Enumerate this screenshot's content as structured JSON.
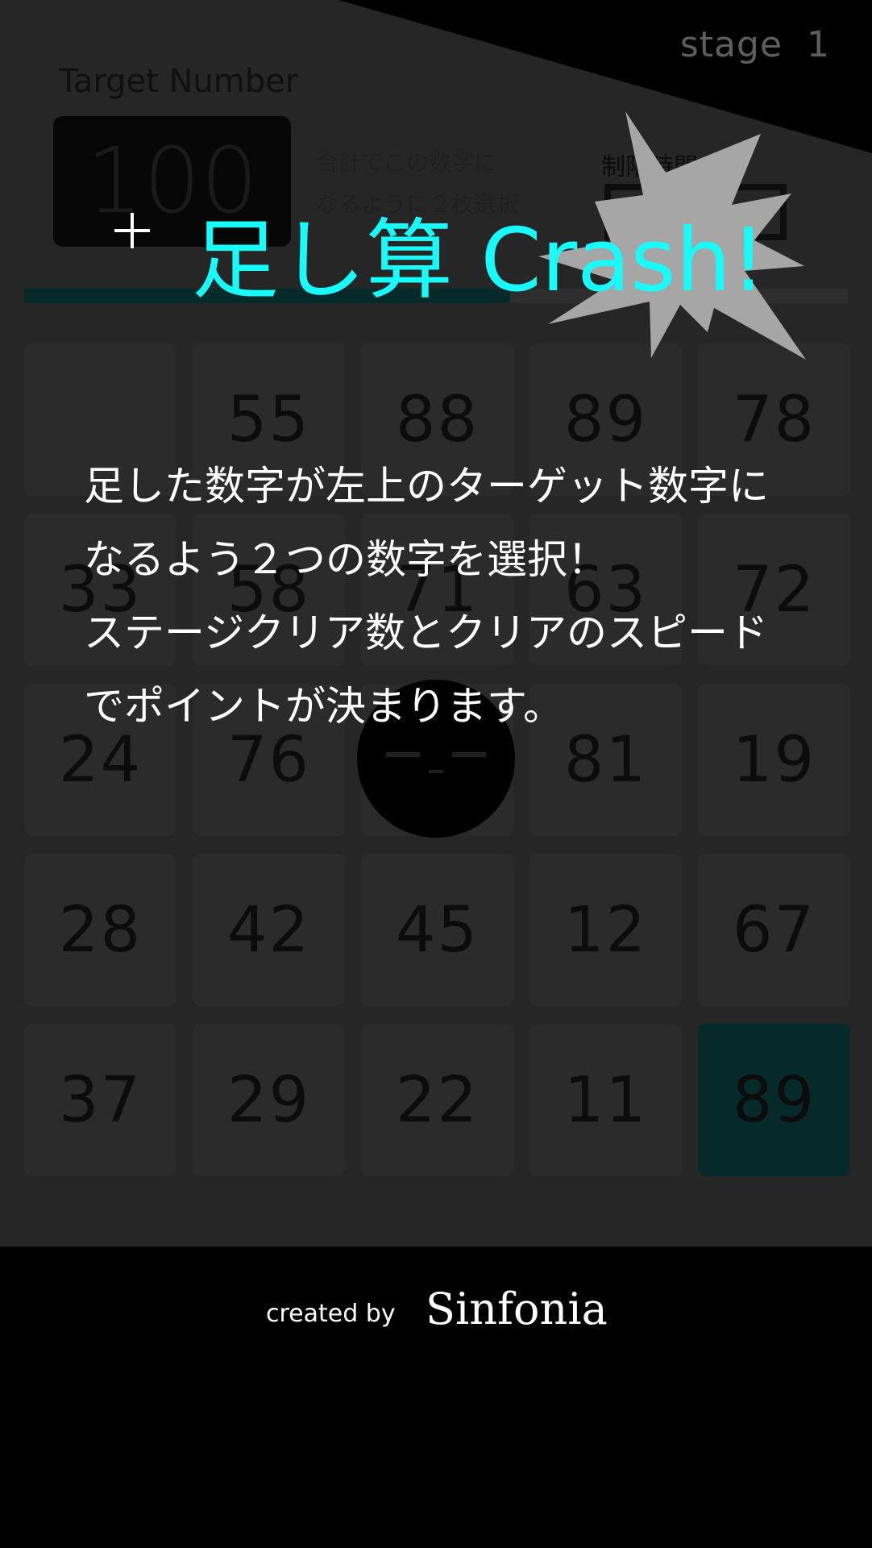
{
  "app": {
    "title": "足し算 Crash!",
    "stage_label": "stage",
    "stage_number": "1"
  },
  "target": {
    "label": "Target Number",
    "value": "100",
    "instruction_line1": "合計でこの数字に",
    "instruction_line2": "なるように２枚選択"
  },
  "timer": {
    "label": "制限時間",
    "remaining_fraction": 0.59
  },
  "board": {
    "rows": [
      [
        "",
        "55",
        "88",
        "89",
        "78"
      ],
      [
        "33",
        "58",
        "71",
        "63",
        "72"
      ],
      [
        "24",
        "76",
        "",
        "81",
        "19"
      ],
      [
        "28",
        "42",
        "45",
        "12",
        "67"
      ],
      [
        "37",
        "29",
        "22",
        "11",
        "89"
      ]
    ],
    "selected_tile": "89"
  },
  "overlay": {
    "title": "足し算 Crash!",
    "description": [
      "足した数字が左上のターゲット数字に",
      "なるよう２つの数字を選択！",
      "ステージクリア数とクリアのスピード",
      "でポイントが決まります。"
    ]
  },
  "footer": {
    "created_by": "created by",
    "brand": "Sinfonia"
  },
  "colors": {
    "title_accent": "#19fbfb",
    "burst": "#a6a6a6",
    "selected_tile": "#062a2a"
  },
  "icons": {
    "plus": "plus-icon",
    "burst": "crash-burst-icon",
    "face": "sleepy-face-icon"
  }
}
